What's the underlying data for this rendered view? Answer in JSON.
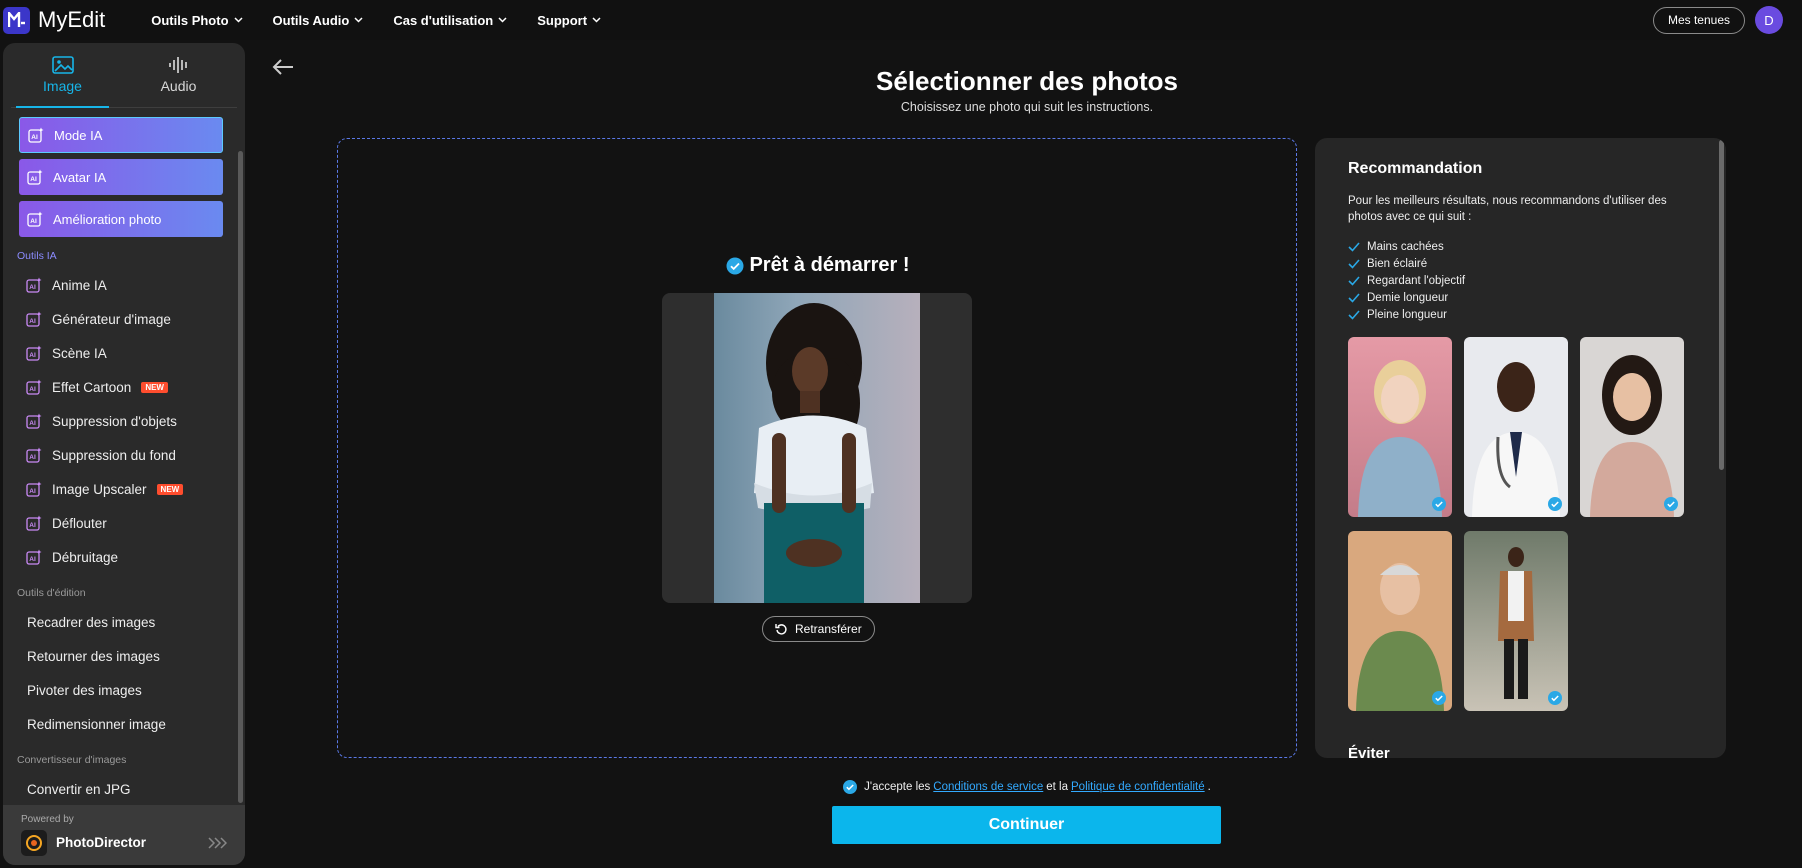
{
  "app": {
    "name": "MyEdit"
  },
  "nav": {
    "items": [
      {
        "label": "Outils Photo"
      },
      {
        "label": "Outils Audio"
      },
      {
        "label": "Cas d'utilisation"
      },
      {
        "label": "Support"
      }
    ],
    "outfits_label": "Mes tenues",
    "avatar_initial": "D"
  },
  "sidebar": {
    "tab_image": "Image",
    "tab_audio": "Audio",
    "modes": [
      {
        "label": "Mode IA"
      },
      {
        "label": "Avatar IA"
      },
      {
        "label": "Amélioration photo"
      }
    ],
    "section_ai": "Outils IA",
    "ai_tools": [
      {
        "label": "Anime IA",
        "badge": ""
      },
      {
        "label": "Générateur d'image",
        "badge": ""
      },
      {
        "label": "Scène IA",
        "badge": ""
      },
      {
        "label": "Effet Cartoon",
        "badge": "NEW"
      },
      {
        "label": "Suppression d'objets",
        "badge": ""
      },
      {
        "label": "Suppression du fond",
        "badge": ""
      },
      {
        "label": "Image Upscaler",
        "badge": "NEW"
      },
      {
        "label": "Déflouter",
        "badge": ""
      },
      {
        "label": "Débruitage",
        "badge": ""
      }
    ],
    "section_edit": "Outils d'édition",
    "edit_tools": [
      {
        "label": "Recadrer des images"
      },
      {
        "label": "Retourner des images"
      },
      {
        "label": "Pivoter des images"
      },
      {
        "label": "Redimensionner image"
      }
    ],
    "section_convert": "Convertisseur d'images",
    "convert_tools": [
      {
        "label": "Convertir en JPG"
      }
    ],
    "powered_by": "Powered by",
    "powered_name": "PhotoDirector"
  },
  "main": {
    "title": "Sélectionner des photos",
    "subtitle": "Choisissez une photo qui suit les instructions.",
    "ready": "Prêt à démarrer !",
    "retransfer": "Retransférer"
  },
  "recommendation": {
    "title": "Recommandation",
    "description": "Pour les meilleurs résultats, nous recommandons d'utiliser des photos avec ce qui suit :",
    "items": [
      "Mains cachées",
      "Bien éclairé",
      "Regardant l'objectif",
      "Demie longueur",
      "Pleine longueur"
    ],
    "avoid_title": "Éviter"
  },
  "footer": {
    "accept_prefix": "J'accepte les",
    "terms_link": "Conditions de service",
    "accept_and": "et la",
    "privacy_link": "Politique de confidentialité",
    "accept_suffix": ".",
    "continue_label": "Continuer"
  },
  "colors": {
    "accent": "#0bb6ec",
    "check": "#2aa8e6",
    "brand": "#3b36c9"
  }
}
